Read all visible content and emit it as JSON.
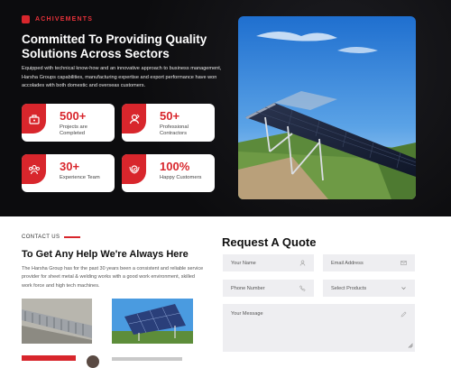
{
  "achievements": {
    "eyebrow": "ACHIVEMENTS",
    "heading": "Committed To Providing Quality Solutions Across Sectors",
    "paragraph": "Equipped with technical know-how and an innovative approach to business management, Harsha Groups capabilities, manufacturing expertise and export performance have won accolades with both domestic and overseas customers.",
    "stats": [
      {
        "value": "500+",
        "label": "Projects are Completed",
        "icon": "project-icon"
      },
      {
        "value": "50+",
        "label": "Professional Contractors",
        "icon": "contractor-icon"
      },
      {
        "value": "30+",
        "label": "Experience Team",
        "icon": "team-icon"
      },
      {
        "value": "100%",
        "label": "Happy Customers",
        "icon": "award-icon"
      }
    ]
  },
  "contact": {
    "eyebrow": "CONTACT US",
    "heading": "To Get Any Help We're Always Here",
    "paragraph": "The Harsha Group has for the past 30 years been a consistent and reliable service provider for sheet metal & welding works with a good work environment, skilled work force and high tech machines."
  },
  "quote": {
    "heading": "Request A Quote",
    "name_placeholder": "Your Name",
    "email_placeholder": "Email Address",
    "phone_placeholder": "Phone Number",
    "select_placeholder": "Select Products",
    "message_placeholder": "Your Message"
  },
  "colors": {
    "accent": "#d8262c",
    "dark_bg": "#0c0c0e"
  }
}
